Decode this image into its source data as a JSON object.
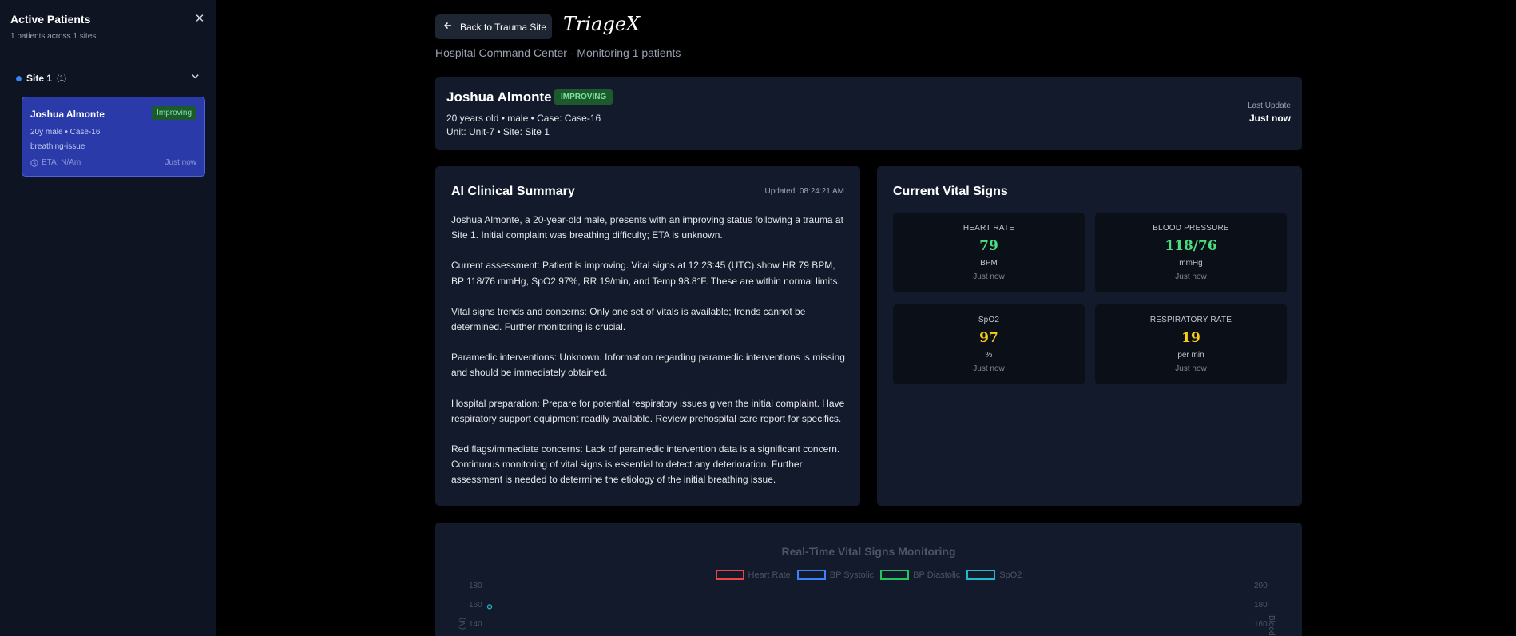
{
  "sidebar": {
    "title": "Active Patients",
    "subtitle": "1 patients across 1 sites",
    "site": {
      "label": "Site 1",
      "count": "(1)"
    },
    "patient": {
      "name": "Joshua Almonte",
      "status": "Improving",
      "line1": "20y male • Case-16",
      "line2": "breathing-issue",
      "eta": "ETA: N/Am",
      "time": "Just now"
    }
  },
  "header": {
    "back_label": "Back to Trauma Site",
    "brand": "TriageX",
    "subtitle": "Hospital Command Center - Monitoring 1 patients"
  },
  "patient": {
    "name": "Joshua Almonte",
    "status": "IMPROVING",
    "line1": "20 years old • male • Case: Case-16",
    "line2": "Unit: Unit-7 • Site: Site 1",
    "last_update_label": "Last Update",
    "last_update_value": "Just now"
  },
  "summary": {
    "title": "AI Clinical Summary",
    "updated": "Updated: 08:24:21 AM",
    "paragraphs": [
      "Joshua Almonte, a 20-year-old male, presents with an improving status following a trauma at Site 1. Initial complaint was breathing difficulty; ETA is unknown.",
      "Current assessment: Patient is improving. Vital signs at 12:23:45 (UTC) show HR 79 BPM, BP 118/76 mmHg, SpO2 97%, RR 19/min, and Temp 98.8°F. These are within normal limits.",
      "Vital signs trends and concerns: Only one set of vitals is available; trends cannot be determined. Further monitoring is crucial.",
      "Paramedic interventions: Unknown. Information regarding paramedic interventions is missing and should be immediately obtained.",
      "Hospital preparation: Prepare for potential respiratory issues given the initial complaint. Have respiratory support equipment readily available. Review prehospital care report for specifics.",
      "Red flags/immediate concerns: Lack of paramedic intervention data is a significant concern. Continuous monitoring of vital signs is essential to detect any deterioration. Further assessment is needed to determine the etiology of the initial breathing issue."
    ]
  },
  "vitals": {
    "title": "Current Vital Signs",
    "cards": [
      {
        "label": "HEART RATE",
        "value": "79",
        "unit": "BPM",
        "time": "Just now",
        "color": "#4ade80"
      },
      {
        "label": "BLOOD PRESSURE",
        "value": "118/76",
        "unit": "mmHg",
        "time": "Just now",
        "color": "#4ade80"
      },
      {
        "label": "SpO2",
        "value": "97",
        "unit": "%",
        "time": "Just now",
        "color": "#facc15"
      },
      {
        "label": "RESPIRATORY RATE",
        "value": "19",
        "unit": "per min",
        "time": "Just now",
        "color": "#facc15"
      }
    ]
  },
  "chart": {
    "title": "Real-Time Vital Signs Monitoring",
    "left_ticks": [
      "180",
      "160",
      "140"
    ],
    "right_ticks": [
      "200",
      "180",
      "160"
    ],
    "left_axis_label": "(M)",
    "right_axis_label": "Blood"
  },
  "chart_data": {
    "type": "line",
    "title": "Real-Time Vital Signs Monitoring",
    "series": [
      {
        "name": "Heart Rate",
        "color": "#ef4444",
        "values": []
      },
      {
        "name": "BP Systolic",
        "color": "#3b82f6",
        "values": []
      },
      {
        "name": "BP Diastolic",
        "color": "#22c55e",
        "values": []
      },
      {
        "name": "SpO2",
        "color": "#22b8cf",
        "values": [
          158
        ]
      }
    ],
    "ylim_left": [
      140,
      180
    ],
    "ylim_right": [
      160,
      200
    ],
    "legend": "top-center",
    "grid": false
  }
}
